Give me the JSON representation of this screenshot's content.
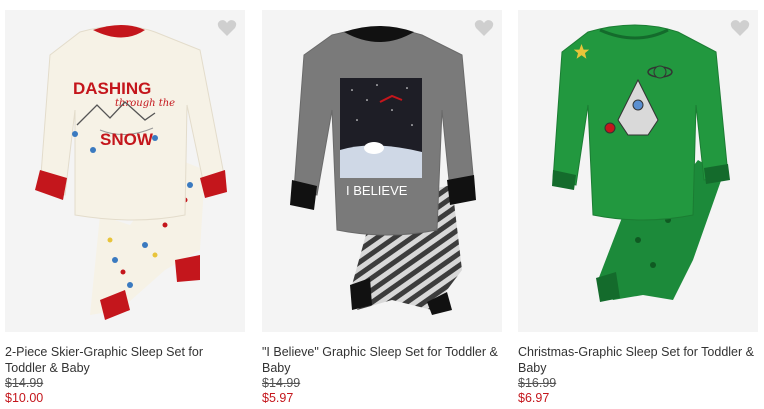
{
  "colors": {
    "sale_price": "#c4161c",
    "image_bg": "#f4f4f4",
    "heart": "#cfcfcf"
  },
  "products": [
    {
      "title": "2-Piece Skier-Graphic Sleep Set for Toddler & Baby",
      "original_price": "$14.99",
      "sale_price": "$10.00",
      "graphic_line1": "DASHING",
      "graphic_line2": "through the",
      "graphic_line3": "SNOW",
      "icon": "heart-icon"
    },
    {
      "title": "\"I Believe\" Graphic Sleep Set for Toddler & Baby",
      "original_price": "$14.99",
      "sale_price": "$5.97",
      "graphic_text": "I BELIEVE",
      "icon": "heart-icon"
    },
    {
      "title": "Christmas-Graphic Sleep Set for Toddler & Baby",
      "original_price": "$16.99",
      "sale_price": "$6.97",
      "icon": "heart-icon"
    }
  ]
}
